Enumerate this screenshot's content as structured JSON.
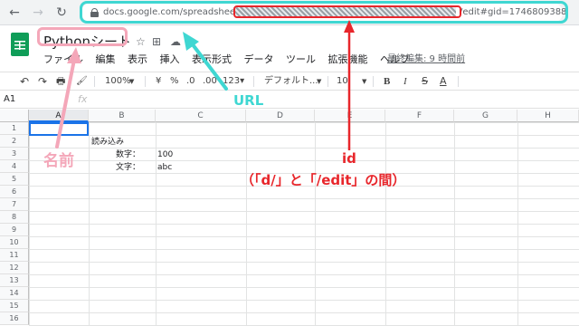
{
  "browser": {
    "back_icon": "arrow-left-icon",
    "forward_icon": "arrow-right-icon",
    "reload_icon": "reload-icon",
    "url_prefix": "docs.google.com/spreadsheets/d/",
    "url_suffix": "/edit#gid=1746809388"
  },
  "doc": {
    "title": "Pythonシート",
    "star_icon": "☆",
    "move_icon": "⊞",
    "cloud_icon": "☁",
    "last_edit": "最終編集: 9 時間前"
  },
  "menu": {
    "items": [
      "ファイル",
      "編集",
      "表示",
      "挿入",
      "表示形式",
      "データ",
      "ツール",
      "拡張機能",
      "ヘルプ"
    ]
  },
  "toolbar": {
    "undo": "↶",
    "redo": "↷",
    "print": "🖶",
    "paint": "🖌",
    "zoom": "100%",
    "currency": "¥",
    "percent": "%",
    "dec_less": ".0",
    "dec_more": ".00",
    "format_more": "123▾",
    "font": "デフォルト...",
    "font_size": "10",
    "bold": "B",
    "italic": "I",
    "strike": "S",
    "text_color": "A"
  },
  "formula_bar": {
    "cell_ref": "A1",
    "fx": "fx"
  },
  "grid": {
    "columns": [
      "A",
      "B",
      "C",
      "D",
      "E",
      "F",
      "G",
      "H"
    ],
    "rows": [
      "1",
      "2",
      "3",
      "4",
      "5",
      "6",
      "7",
      "8",
      "9",
      "10",
      "11",
      "12",
      "13",
      "14",
      "15",
      "16"
    ],
    "cells": {
      "b2": "読み込み",
      "b3_label": "数字：",
      "c3": "100",
      "b4_label": "文字：",
      "c4": "abc"
    }
  },
  "annotations": {
    "name_label": "名前",
    "url_label": "URL",
    "id_label": "id",
    "id_note": "（「d/」と「/edit」の間）",
    "colors": {
      "name": "#f4a7b9",
      "url": "#3fd7d2",
      "id": "#e8262b"
    }
  }
}
